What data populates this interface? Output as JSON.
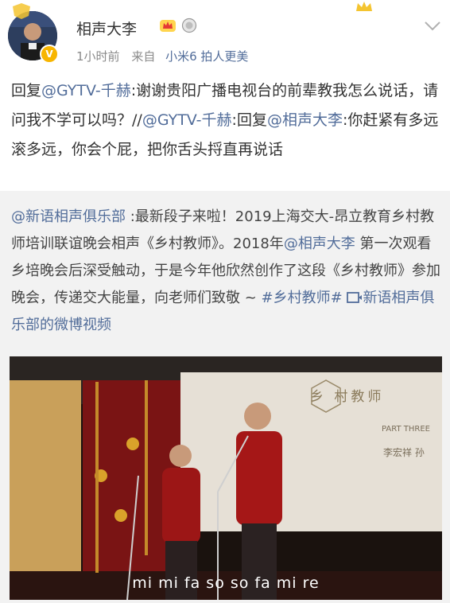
{
  "header": {
    "username": "相声大李",
    "time": "1小时前",
    "from_label": "来自",
    "source": "小米6 拍人更美"
  },
  "post": {
    "prefix": "回复",
    "mention1": "@GYTV-千赫",
    "text1": ":谢谢贵阳广播电视台的前辈教我怎么说话，请问我不学可以吗？//",
    "mention2": "@GYTV-千赫",
    "text2": ":回复",
    "mention3": "@相声大李",
    "text3": ":你赶紧有多远滚多远，你会个屁，把你舌头捋直再说话"
  },
  "repost": {
    "mention": "@新语相声俱乐部",
    "text1": " :最新段子来啦！2019上海交大-昂立教育乡村教师培训联谊晚会相声《乡村教师》。2018年",
    "mention2": "@相声大李",
    "text2": " 第一次观看乡培晚会后深受触动，于是今年他欣然创作了这段《乡村教师》参加晚会，传递交大能量，向老师们致敬 ~ ",
    "hashtag": "#乡村教师#",
    "video_link": "新语相声俱乐部的微博视频"
  },
  "video": {
    "subtitle": "mi mi fa so so fa mi re",
    "screen_title": "乡 村教师",
    "screen_sub1": "PART THREE",
    "screen_sub2": "李宏祥 孙"
  },
  "colors": {
    "link": "#526d9a",
    "vip": "#f7b500"
  }
}
